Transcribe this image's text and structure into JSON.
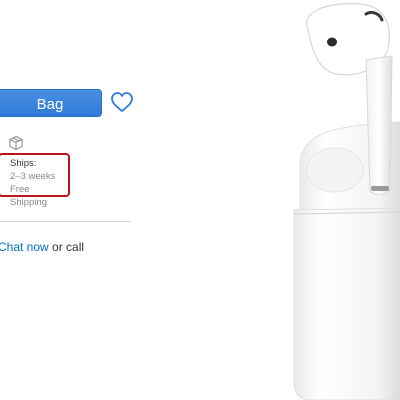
{
  "buy": {
    "bag_button_label": "Bag"
  },
  "icons": {
    "favorite": "heart-icon",
    "shipping": "box-icon"
  },
  "shipping": {
    "title": "Ships:",
    "eta": "2–3 weeks",
    "cost": "Free Shipping",
    "highlight_color": "#c0141b"
  },
  "help": {
    "chat_link": "Chat now",
    "tail": " or call",
    "fragment": "·"
  },
  "colors": {
    "accent": "#2f7bd6",
    "link": "#0070c9"
  }
}
